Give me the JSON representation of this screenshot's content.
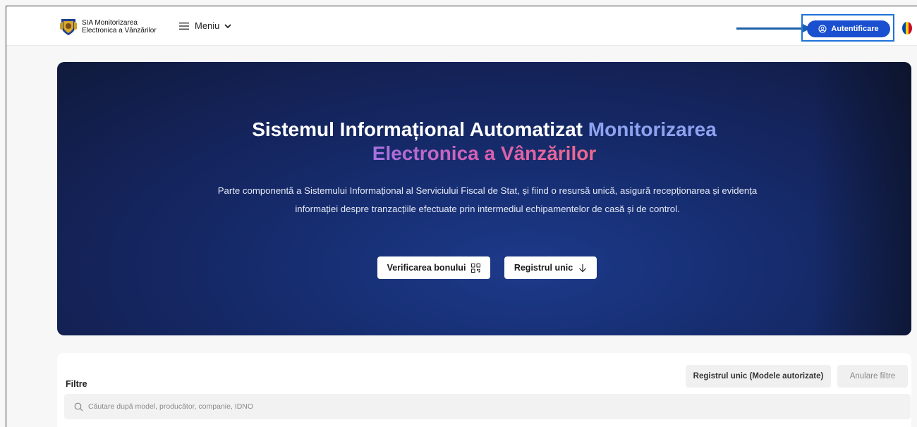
{
  "header": {
    "logo_line1": "SIA Monitorizarea",
    "logo_line2": "Electronica a Vânzărilor",
    "menu_label": "Meniu",
    "auth_label": "Autentificare"
  },
  "colors": {
    "accent_blue": "#1a4fd0",
    "highlight_border": "#1e73d8",
    "arrow": "#1b5fa8",
    "flag": [
      "#0046ae",
      "#ffd200",
      "#cc092f"
    ]
  },
  "hero": {
    "title_part1": "Sistemul Informațional Automatizat ",
    "title_part2": "Monitorizarea",
    "title_part3": "Electronica a Vânzărilor",
    "description": "Parte componentă a Sistemului Informațional al Serviciului Fiscal de Stat, și fiind o resursă unică, asigură recepționarea și evidența informației despre tranzacțiile efectuate prin intermediul echipamentelor de casă și de control.",
    "btn_verify": "Verificarea bonului",
    "btn_registry": "Registrul unic"
  },
  "filters": {
    "label": "Filtre",
    "btn_registry_models": "Registrul unic (Modele autorizate)",
    "btn_cancel": "Anulare filtre",
    "search_placeholder": "Căutare după model, producător, companie, IDNO"
  },
  "icons": {
    "menu": "hamburger-icon",
    "menu_chevron": "chevron-down-icon",
    "auth": "user-circle-icon",
    "verify": "qr-code-icon",
    "registry": "arrow-down-icon",
    "search": "search-icon"
  }
}
